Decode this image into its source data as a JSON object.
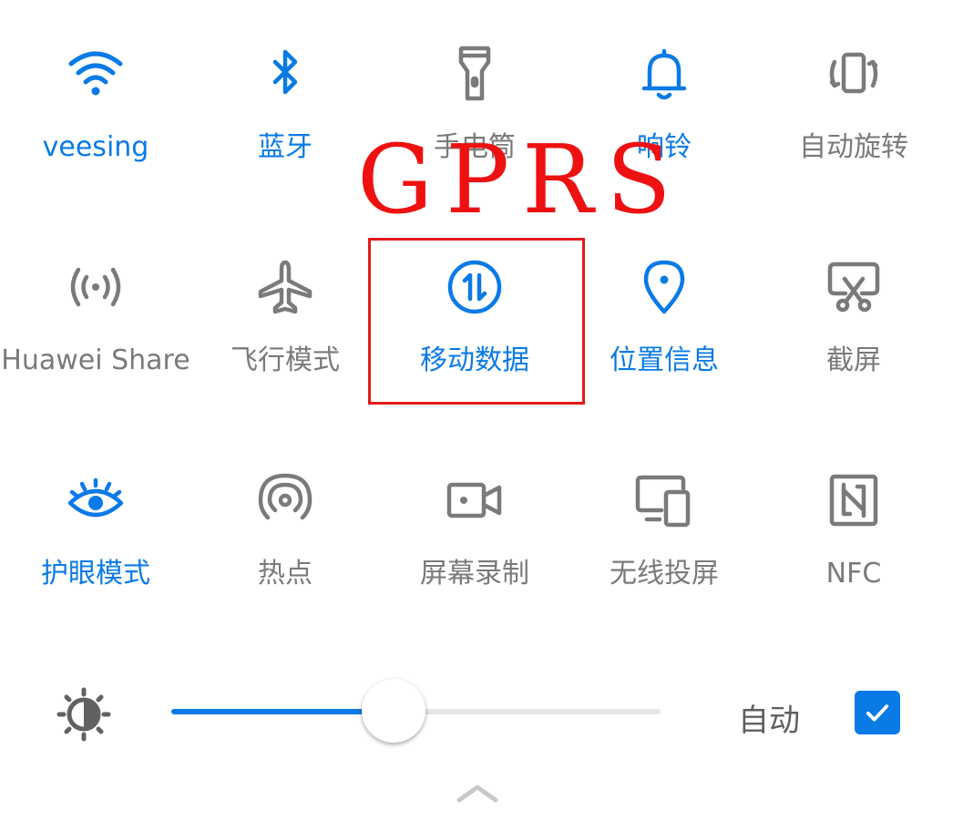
{
  "annotation": {
    "text": "GPRS",
    "color": "#ee1111",
    "box_color": "#e31b1b"
  },
  "colors": {
    "active": "#0a7ae6",
    "inactive": "#7a7a7a"
  },
  "tiles": [
    {
      "label": "veesing",
      "icon": "wifi-icon",
      "active": true
    },
    {
      "label": "蓝牙",
      "icon": "bluetooth-icon",
      "active": true
    },
    {
      "label": "手电筒",
      "icon": "flashlight-icon",
      "active": false
    },
    {
      "label": "响铃",
      "icon": "bell-icon",
      "active": true
    },
    {
      "label": "自动旋转",
      "icon": "auto-rotate-icon",
      "active": false
    },
    {
      "label": "Huawei Share",
      "icon": "huawei-share-icon",
      "active": false
    },
    {
      "label": "飞行模式",
      "icon": "airplane-icon",
      "active": false
    },
    {
      "label": "移动数据",
      "icon": "mobile-data-icon",
      "active": true
    },
    {
      "label": "位置信息",
      "icon": "location-icon",
      "active": true
    },
    {
      "label": "截屏",
      "icon": "screenshot-icon",
      "active": false
    },
    {
      "label": "护眼模式",
      "icon": "eye-icon",
      "active": true
    },
    {
      "label": "热点",
      "icon": "hotspot-icon",
      "active": false
    },
    {
      "label": "屏幕录制",
      "icon": "screen-record-icon",
      "active": false
    },
    {
      "label": "无线投屏",
      "icon": "wireless-projection-icon",
      "active": false
    },
    {
      "label": "NFC",
      "icon": "nfc-icon",
      "active": false
    }
  ],
  "brightness": {
    "icon": "brightness-icon",
    "level": 0.455,
    "auto_label": "自动",
    "auto_checked": true,
    "check_icon": "checkmark-icon"
  },
  "collapse_icon": "chevron-up-icon"
}
